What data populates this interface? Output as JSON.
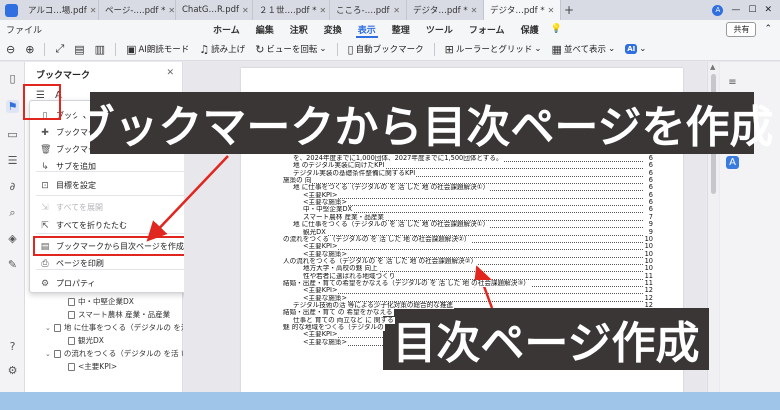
{
  "tabs": [
    {
      "label": "アルコ…場.pdf",
      "active": false
    },
    {
      "label": "ページ-….pdf *",
      "active": false
    },
    {
      "label": "ChatG…R.pdf",
      "active": false
    },
    {
      "label": "２１世….pdf *",
      "active": false
    },
    {
      "label": "こころ-….pdf",
      "active": false
    },
    {
      "label": "デジタ…pdf *",
      "active": false
    },
    {
      "label": "デジタ…pdf *",
      "active": true
    }
  ],
  "window": {
    "avatar_letter": "A",
    "minimize": "—",
    "maximize": "☐",
    "close": "✕"
  },
  "menubar": {
    "file": "ファイル",
    "items": [
      "ホーム",
      "編集",
      "注釈",
      "変換",
      "表示",
      "整理",
      "ツール",
      "フォーム",
      "保護"
    ],
    "active_index": 4,
    "share": "共有"
  },
  "toolbar": {
    "ai_read": "AI朗読モード",
    "read_aloud": "読み上げ",
    "rotate": "ビューを回転",
    "auto_bookmark": "自動ブックマーク",
    "rulers": "ルーラーとグリッド",
    "arrange": "並べて表示",
    "ai_label": "AI"
  },
  "panel": {
    "title": "ブックマーク"
  },
  "context_menu": {
    "items": [
      {
        "label": "ブックマーク",
        "icon": "bookmark-icon",
        "disabled": false
      },
      {
        "label": "ブックマー",
        "icon": "bookmark-add-icon",
        "disabled": false
      },
      {
        "label": "ブックマークを削除",
        "icon": "trash-icon",
        "disabled": false
      },
      {
        "label": "サブを追加",
        "icon": "sub-add-icon",
        "disabled": false
      },
      {
        "label": "目標を設定",
        "icon": "target-icon",
        "disabled": false
      },
      {
        "label": "すべてを展開",
        "icon": "expand-icon",
        "disabled": true
      },
      {
        "label": "すべてを折りたたむ",
        "icon": "collapse-icon",
        "disabled": false
      },
      {
        "label": "ブックマークから目次ページを作成",
        "icon": "toc-create-icon",
        "disabled": false
      },
      {
        "label": "ページを印刷",
        "icon": "print-icon",
        "disabled": false
      },
      {
        "label": "プロパティ",
        "icon": "properties-icon",
        "disabled": false
      }
    ]
  },
  "tree": [
    {
      "label": "中・中堅企業DX",
      "indent": 2,
      "expand": ""
    },
    {
      "label": "スマート農林 産業・品産業",
      "indent": 2,
      "expand": ""
    },
    {
      "label": "地 に仕事をつくる（デジタルの を活",
      "indent": 1,
      "expand": "⌄"
    },
    {
      "label": "観光DX",
      "indent": 2,
      "expand": ""
    },
    {
      "label": "の流れをつくる（デジタルの を活 い",
      "indent": 1,
      "expand": "⌄"
    },
    {
      "label": "<主要KPI>",
      "indent": 2,
      "expand": ""
    }
  ],
  "toc": [
    {
      "text": "を、2024年度までに1,000団体、2027年度までに1,500団体とする。",
      "num": "6",
      "indent": 0
    },
    {
      "text": "地 のデジタル実装に向けたKPI",
      "num": "6",
      "indent": 0
    },
    {
      "text": "デジタル実装の基礎条件整備に関するKPI",
      "num": "6",
      "indent": 0
    },
    {
      "text": "施策の 向",
      "num": "6",
      "indent": -1
    },
    {
      "text": "地 に仕事をつくる（デジタルの を 活 した 地 の社会課題解決①）",
      "num": "6",
      "indent": 0
    },
    {
      "text": "<主要KPI>",
      "num": "6",
      "indent": 1
    },
    {
      "text": "<主要な施策>",
      "num": "6",
      "indent": 1
    },
    {
      "text": "中・中堅企業DX",
      "num": "6",
      "indent": 1
    },
    {
      "text": "スマート農林 産業・品産業",
      "num": "7",
      "indent": 1
    },
    {
      "text": "地 に仕事をつくる（デジタルの を 活 した 地 の社会課題解決①）",
      "num": "9",
      "indent": 0
    },
    {
      "text": "観光DX",
      "num": "9",
      "indent": 1
    },
    {
      "text": "の流れをつくる（デジタルの を 活 した 地 の社会課題解決②）",
      "num": "10",
      "indent": -1
    },
    {
      "text": "<主要KPI>",
      "num": "10",
      "indent": 1
    },
    {
      "text": "<主要な施策>",
      "num": "10",
      "indent": 1
    },
    {
      "text": "人の流れをつくる（デジタルの を 活 した 地 の社会課題解決②）",
      "num": "10",
      "indent": -1
    },
    {
      "text": "地方大学・高校の魅 向上",
      "num": "10",
      "indent": 1
    },
    {
      "text": "性や若者に選ばれる地域づくり",
      "num": "11",
      "indent": 1
    },
    {
      "text": "結婚・出産・育ての希望をかなえる（デジタルの を 活 した 地 の社会課題解決③）",
      "num": "11",
      "indent": -1
    },
    {
      "text": "<主要KPI>",
      "num": "12",
      "indent": 1
    },
    {
      "text": "<主要な施策>",
      "num": "12",
      "indent": 1
    },
    {
      "text": "デジタル技術の活 等による少子化対策の総合的な推進",
      "num": "12",
      "indent": 0
    },
    {
      "text": "結婚・出産・育て の 希望をかなえる",
      "num": "12",
      "indent": -1
    },
    {
      "text": "仕事と 育ての 両立など に 関する",
      "num": "13",
      "indent": 0
    },
    {
      "text": "魅 的な地域をつくる（デジタルの",
      "num": "13",
      "indent": -1
    },
    {
      "text": "<主要KPI>",
      "num": "13",
      "indent": 1
    },
    {
      "text": "<主要な施策>",
      "num": "13",
      "indent": 1
    }
  ],
  "callouts": {
    "main": "ブックマークから目次ページを作成",
    "sub": "目次ページ作成"
  },
  "colors": {
    "accent": "#2f6fe0",
    "highlight": "#e0261e",
    "callout_bg": "#3a3636"
  }
}
